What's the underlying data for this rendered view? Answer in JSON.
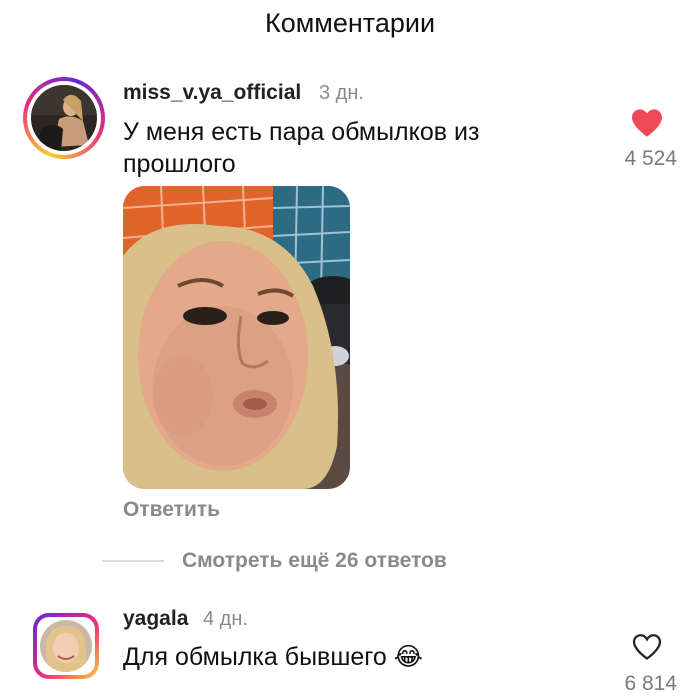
{
  "header": {
    "title": "Комментарии"
  },
  "comments": [
    {
      "username": "miss_v.ya_official",
      "time": "3 дн.",
      "text_line1": "У меня есть пара обмылков из",
      "text_line2": "прошлого",
      "likes": "4 524",
      "liked": true,
      "reply_label": "Ответить",
      "has_media": true
    },
    {
      "username": "yagala",
      "time": "4 дн.",
      "text": "Для обмылка бывшего",
      "emoji": "😂",
      "likes": "6 814",
      "liked": false
    }
  ],
  "thread": {
    "more_replies_label": "Смотреть ещё 26 ответов"
  },
  "colors": {
    "like_red": "#ed4956",
    "muted": "#8a8a8a",
    "divider": "#dcdcdc"
  }
}
